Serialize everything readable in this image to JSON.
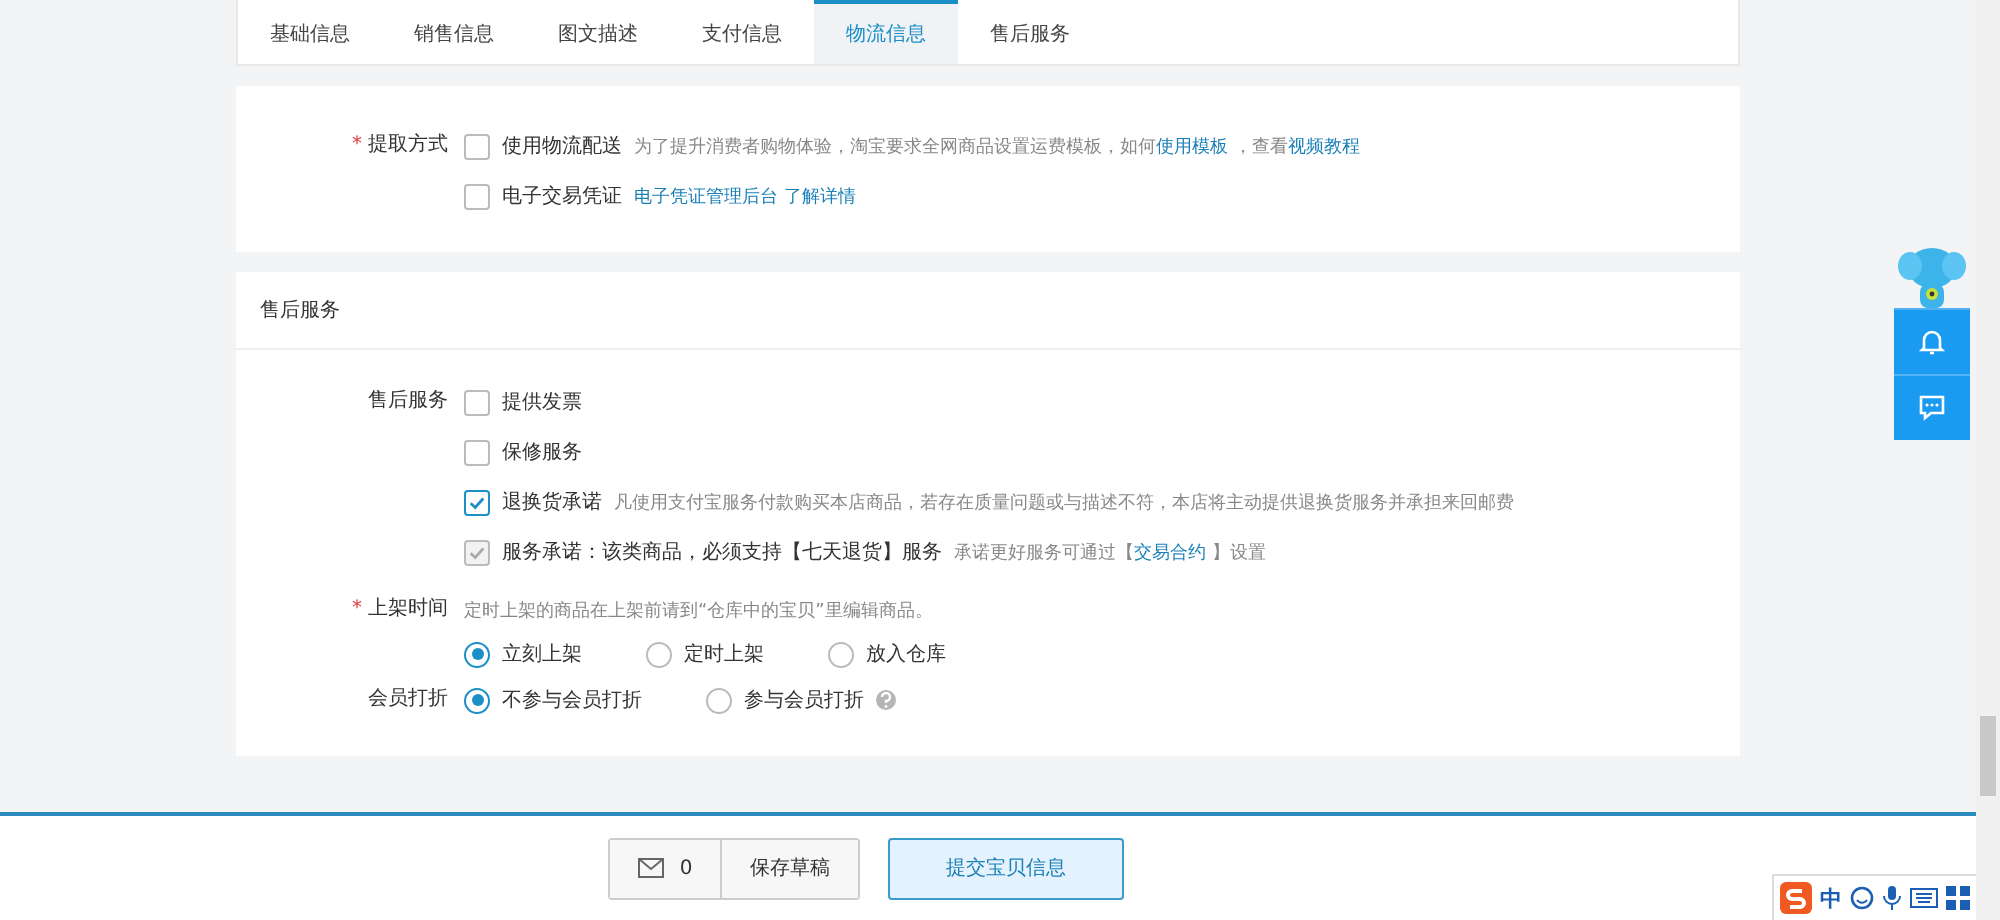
{
  "tabs": [
    {
      "label": "基础信息",
      "selected": false
    },
    {
      "label": "销售信息",
      "selected": false
    },
    {
      "label": "图文描述",
      "selected": false
    },
    {
      "label": "支付信息",
      "selected": false
    },
    {
      "label": "物流信息",
      "selected": true
    },
    {
      "label": "售后服务",
      "selected": false
    }
  ],
  "pickup": {
    "label": "提取方式",
    "required_mark": "*",
    "options": [
      {
        "label": "使用物流配送",
        "checked": false,
        "disabled": false,
        "parts": [
          {
            "kind": "text",
            "text": "为了提升消费者购物体验，淘宝要求全网商品设置运费模板，如何"
          },
          {
            "kind": "link",
            "text": "使用模板"
          },
          {
            "kind": "text",
            "text": "，查看"
          },
          {
            "kind": "link",
            "text": "视频教程"
          }
        ]
      },
      {
        "label": "电子交易凭证",
        "checked": false,
        "disabled": false,
        "parts": [
          {
            "kind": "link",
            "text": "电子凭证管理后台"
          },
          {
            "kind": "link",
            "text": "了解详情"
          }
        ]
      }
    ]
  },
  "after_sales": {
    "title": "售后服务",
    "label": "售后服务",
    "options": [
      {
        "label": "提供发票",
        "checked": false,
        "disabled": false
      },
      {
        "label": "保修服务",
        "checked": false,
        "disabled": false
      },
      {
        "label": "退换货承诺",
        "checked": true,
        "disabled": false,
        "parts": [
          {
            "kind": "text",
            "text": "凡使用支付宝服务付款购买本店商品，若存在质量问题或与描述不符，本店将主动提供退换货服务并承担来回邮费"
          }
        ]
      },
      {
        "label": "服务承诺：该类商品，必须支持【七天退货】服务",
        "checked": true,
        "disabled": true,
        "parts": [
          {
            "kind": "text",
            "text": "承诺更好服务可通过【"
          },
          {
            "kind": "link",
            "text": "交易合约"
          },
          {
            "kind": "text",
            "text": "】设置"
          }
        ]
      }
    ]
  },
  "listing_time": {
    "label": "上架时间",
    "required_mark": "*",
    "hint": "定时上架的商品在上架前请到“仓库中的宝贝”里编辑商品。",
    "options": [
      {
        "label": "立刻上架",
        "selected": true
      },
      {
        "label": "定时上架",
        "selected": false
      },
      {
        "label": "放入仓库",
        "selected": false
      }
    ]
  },
  "member_discount": {
    "label": "会员打折",
    "options": [
      {
        "label": "不参与会员打折",
        "selected": true,
        "help": false
      },
      {
        "label": "参与会员打折",
        "selected": false,
        "help": true
      }
    ]
  },
  "footer": {
    "message_count": "0",
    "save_draft": "保存草稿",
    "submit": "提交宝贝信息"
  },
  "ime_toolbar": {
    "language": "中"
  }
}
